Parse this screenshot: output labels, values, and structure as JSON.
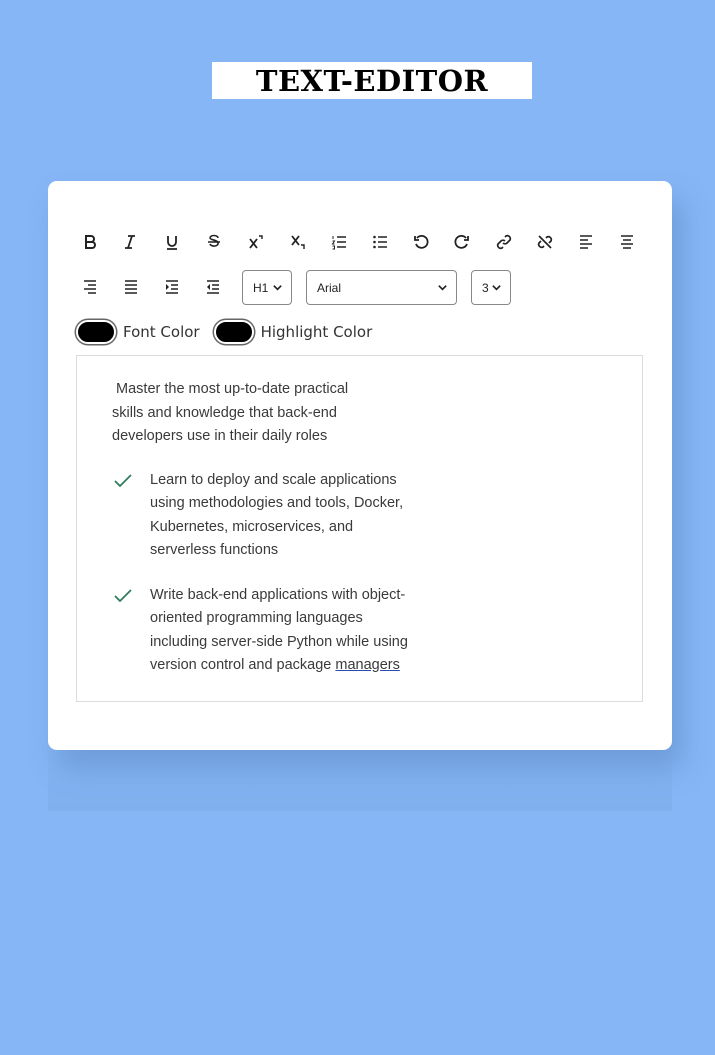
{
  "page_title": "TEXT-EDITOR",
  "toolbar": {
    "row1": [
      {
        "name": "bold-button",
        "icon": "bold-icon",
        "label": "B"
      },
      {
        "name": "italic-button",
        "icon": "italic-icon",
        "label": "I"
      },
      {
        "name": "underline-button",
        "icon": "underline-icon",
        "label": "U"
      },
      {
        "name": "strikethrough-button",
        "icon": "strikethrough-icon",
        "label": "S"
      },
      {
        "name": "superscript-button",
        "icon": "superscript-icon",
        "label": "X¹"
      },
      {
        "name": "subscript-button",
        "icon": "subscript-icon",
        "label": "X₁"
      },
      {
        "name": "ordered-list-button",
        "icon": "ordered-list-icon"
      },
      {
        "name": "unordered-list-button",
        "icon": "unordered-list-icon"
      },
      {
        "name": "undo-button",
        "icon": "undo-icon"
      },
      {
        "name": "redo-button",
        "icon": "redo-icon"
      },
      {
        "name": "link-button",
        "icon": "link-icon"
      },
      {
        "name": "unlink-button",
        "icon": "unlink-icon"
      },
      {
        "name": "align-left-button",
        "icon": "align-left-icon"
      },
      {
        "name": "align-center-button",
        "icon": "align-center-icon"
      }
    ],
    "row2": [
      {
        "name": "align-right-button",
        "icon": "align-right-icon"
      },
      {
        "name": "align-justify-button",
        "icon": "align-justify-icon"
      },
      {
        "name": "indent-button",
        "icon": "indent-icon"
      },
      {
        "name": "outdent-button",
        "icon": "outdent-icon"
      }
    ],
    "heading_select": "H1",
    "font_select": "Arial",
    "size_select": "3"
  },
  "colors": {
    "font_color_label": "Font Color",
    "highlight_color_label": "Highlight Color",
    "font_color_value": "#000000",
    "highlight_color_value": "#000000"
  },
  "content": {
    "intro_lines": [
      " Master the most up-to-date practical",
      "skills and knowledge that back-end",
      "developers use in their daily roles"
    ],
    "bullets": [
      {
        "lines": [
          "Learn to deploy and scale applications",
          "using methodologies and tools, Docker,",
          "Kubernetes, microservices, and",
          "serverless functions"
        ]
      },
      {
        "lines": [
          "Write back-end applications with object-",
          "oriented programming languages",
          "including server-side Python while using"
        ],
        "last_prefix": "version control and package ",
        "last_underlined": "managers"
      }
    ]
  },
  "accent": {
    "background": "#86b6f6",
    "check": "#2f7d5a"
  }
}
